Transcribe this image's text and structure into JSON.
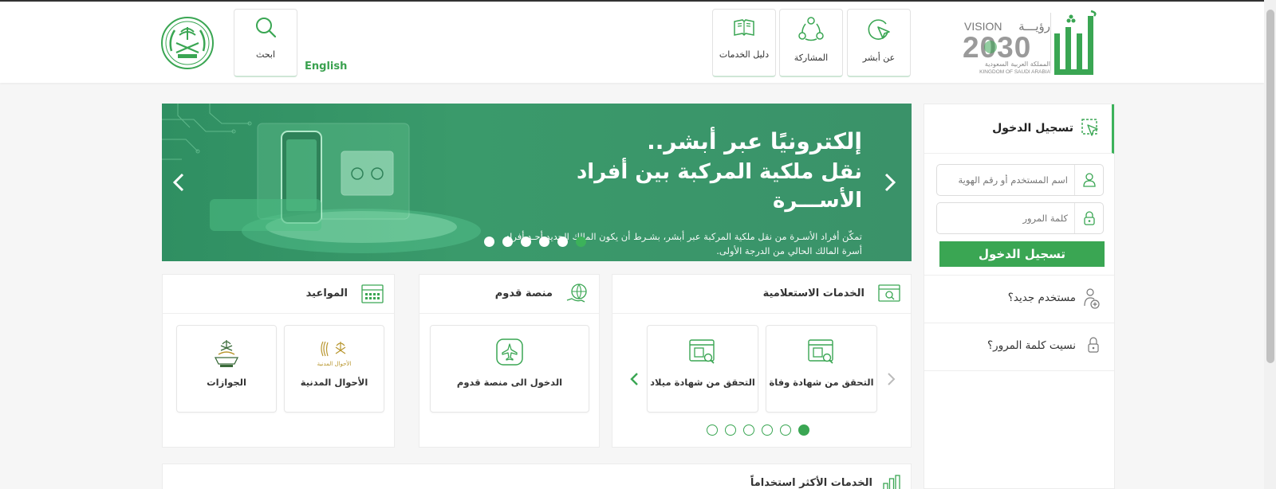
{
  "header": {
    "nav": [
      {
        "label": "عن أبشر",
        "icon": "cursor-circle-icon"
      },
      {
        "label": "المشاركة",
        "icon": "share-network-icon"
      },
      {
        "label": "دليل الخدمات",
        "icon": "open-book-icon"
      }
    ],
    "search_label": "ابحث",
    "lang_label": "English",
    "vision_logo": {
      "line1": "VISION",
      "arabic_title": "رؤيـــة",
      "year": "2030",
      "kingdom_ar": "المملكة العربية السعودية",
      "kingdom_en": "KINGDOM OF SAUDI ARABIA"
    },
    "absher_logo": "أبشر"
  },
  "banner": {
    "title_line1": "إلكترونيًا عبر أبشر..",
    "title_line2": "نقل ملكية المركبة بين أفراد الأســـرة",
    "description": "تمكّن أفراد الأسـرة من نقل ملكية المركبة عبر أبشر، بشـرط أن يكون المالك الجديد أحـد أفراد أسرة المالك الحالي من الدرجة الأولى.",
    "dots_count": 6,
    "active_dot": 5
  },
  "login": {
    "title": "تسجيل الدخول",
    "username_placeholder": "اسم المستخدم أو رقم الهوية",
    "password_placeholder": "كلمة المرور",
    "login_button": "تسجيل الدخول",
    "new_user": "مستخدم جديد؟",
    "forgot_password": "نسيت كلمة المرور؟"
  },
  "cards": {
    "inquiry": {
      "title": "الخدمات الاستعلامية",
      "tiles": [
        "التحقق من شهادة وفاة",
        "التحقق من شهادة ميلاد"
      ],
      "dots_count": 6,
      "active_dot": 5
    },
    "arrival": {
      "title": "منصة قدوم",
      "tiles": [
        "الدخول الى منصة قدوم"
      ]
    },
    "appointments": {
      "title": "المواعيد",
      "tiles": [
        "الأحوال المدنية",
        "الجوازات"
      ],
      "civil_logo_text": "الأحوال المدنية"
    }
  },
  "most_used": {
    "title": "الخدمات الأكثر استخداماً"
  },
  "colors": {
    "brand_green": "#3aa653",
    "banner_green": "#3a9a6b"
  }
}
